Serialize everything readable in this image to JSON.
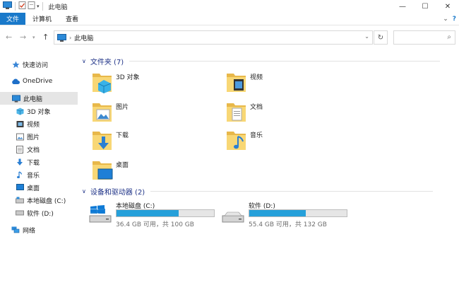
{
  "window": {
    "title": "此电脑",
    "minimize_glyph": "—",
    "maximize_glyph": "☐",
    "close_glyph": "✕"
  },
  "ribbon": {
    "tabs": [
      "文件",
      "计算机",
      "查看"
    ],
    "help_glyph": "?",
    "expand_glyph": "⌄"
  },
  "address": {
    "crumb": "此电脑",
    "refresh_glyph": "↻",
    "search_glyph": "⌕"
  },
  "nav": {
    "quick_access": "快速访问",
    "onedrive": "OneDrive",
    "this_pc": "此电脑",
    "children": [
      "3D 对象",
      "视频",
      "图片",
      "文档",
      "下载",
      "音乐",
      "桌面",
      "本地磁盘 (C:)",
      "软件 (D:)"
    ],
    "network": "网络"
  },
  "content": {
    "folders_header": "文件夹 (7)",
    "folders": [
      "3D 对象",
      "视频",
      "图片",
      "文档",
      "下载",
      "音乐",
      "桌面"
    ],
    "devices_header": "设备和驱动器 (2)",
    "drives": [
      {
        "name": "本地磁盘 (C:)",
        "free_text": "36.4 GB 可用，共 100 GB",
        "used_fraction": 0.636
      },
      {
        "name": "软件 (D:)",
        "free_text": "55.4 GB 可用，共 132 GB",
        "used_fraction": 0.58
      }
    ]
  },
  "colors": {
    "accent": "#1979ca",
    "header_blue": "#1e3287",
    "bar_fill": "#26a0da",
    "folder_yellow": "#f8d775"
  }
}
